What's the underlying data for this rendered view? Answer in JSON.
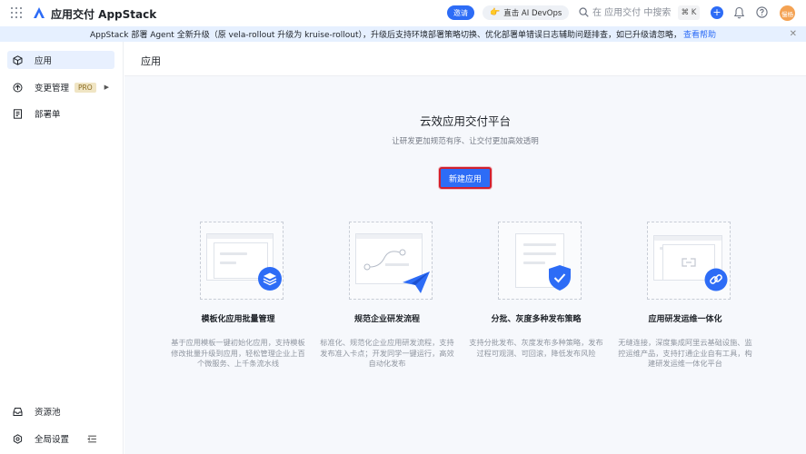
{
  "header": {
    "app_title": "应用交付 AppStack",
    "invite_label": "邀请",
    "ai_label": "直击 AI DevOps",
    "search_placeholder": "在 应用交付 中搜索",
    "shortcut": "⌘ K",
    "plus": "+",
    "avatar_text": "慢杨"
  },
  "banner": {
    "text": "AppStack 部署 Agent 全新升级（原 vela-rollout 升级为 kruise-rollout），升级后支持环境部署策略切换、优化部署单错误日志辅助问题排查，如已升级请忽略，",
    "link": "查看帮助"
  },
  "sidebar": {
    "items": [
      {
        "label": "应用",
        "icon": "cube-icon"
      },
      {
        "label": "变更管理",
        "badge": "PRO",
        "icon": "change-icon"
      },
      {
        "label": "部署单",
        "icon": "document-icon"
      }
    ],
    "bottom": [
      {
        "label": "资源池",
        "icon": "inbox-icon"
      },
      {
        "label": "全局设置",
        "icon": "gear-icon"
      }
    ]
  },
  "main": {
    "page_title": "应用",
    "hero_title": "云效应用交付平台",
    "hero_subtitle": "让研发更加规范有序、让交付更加高效透明",
    "create_button": "新建应用",
    "features": [
      {
        "title": "模板化应用批量管理",
        "desc": "基于应用模板一键初始化应用，支持模板修改批量升级到应用，轻松管理企业上百个微服务、上千条流水线"
      },
      {
        "title": "规范企业研发流程",
        "desc": "标准化、规范化企业应用研发流程，支持发布准入卡点；开发同学一键运行，高效自动化发布"
      },
      {
        "title": "分批、灰度多种发布策略",
        "desc": "支持分批发布、灰度发布多种策略，发布过程可观测、可回滚，降低发布风险"
      },
      {
        "title": "应用研发运维一体化",
        "desc": "无缝连接，深度集成阿里云基础设施、监控运维产品，支持打通企业自有工具，构建研发运维一体化平台"
      }
    ]
  },
  "colors": {
    "accent": "#2d6cf6",
    "highlight_border": "#d1202f",
    "banner_bg": "#e6f0ff"
  }
}
